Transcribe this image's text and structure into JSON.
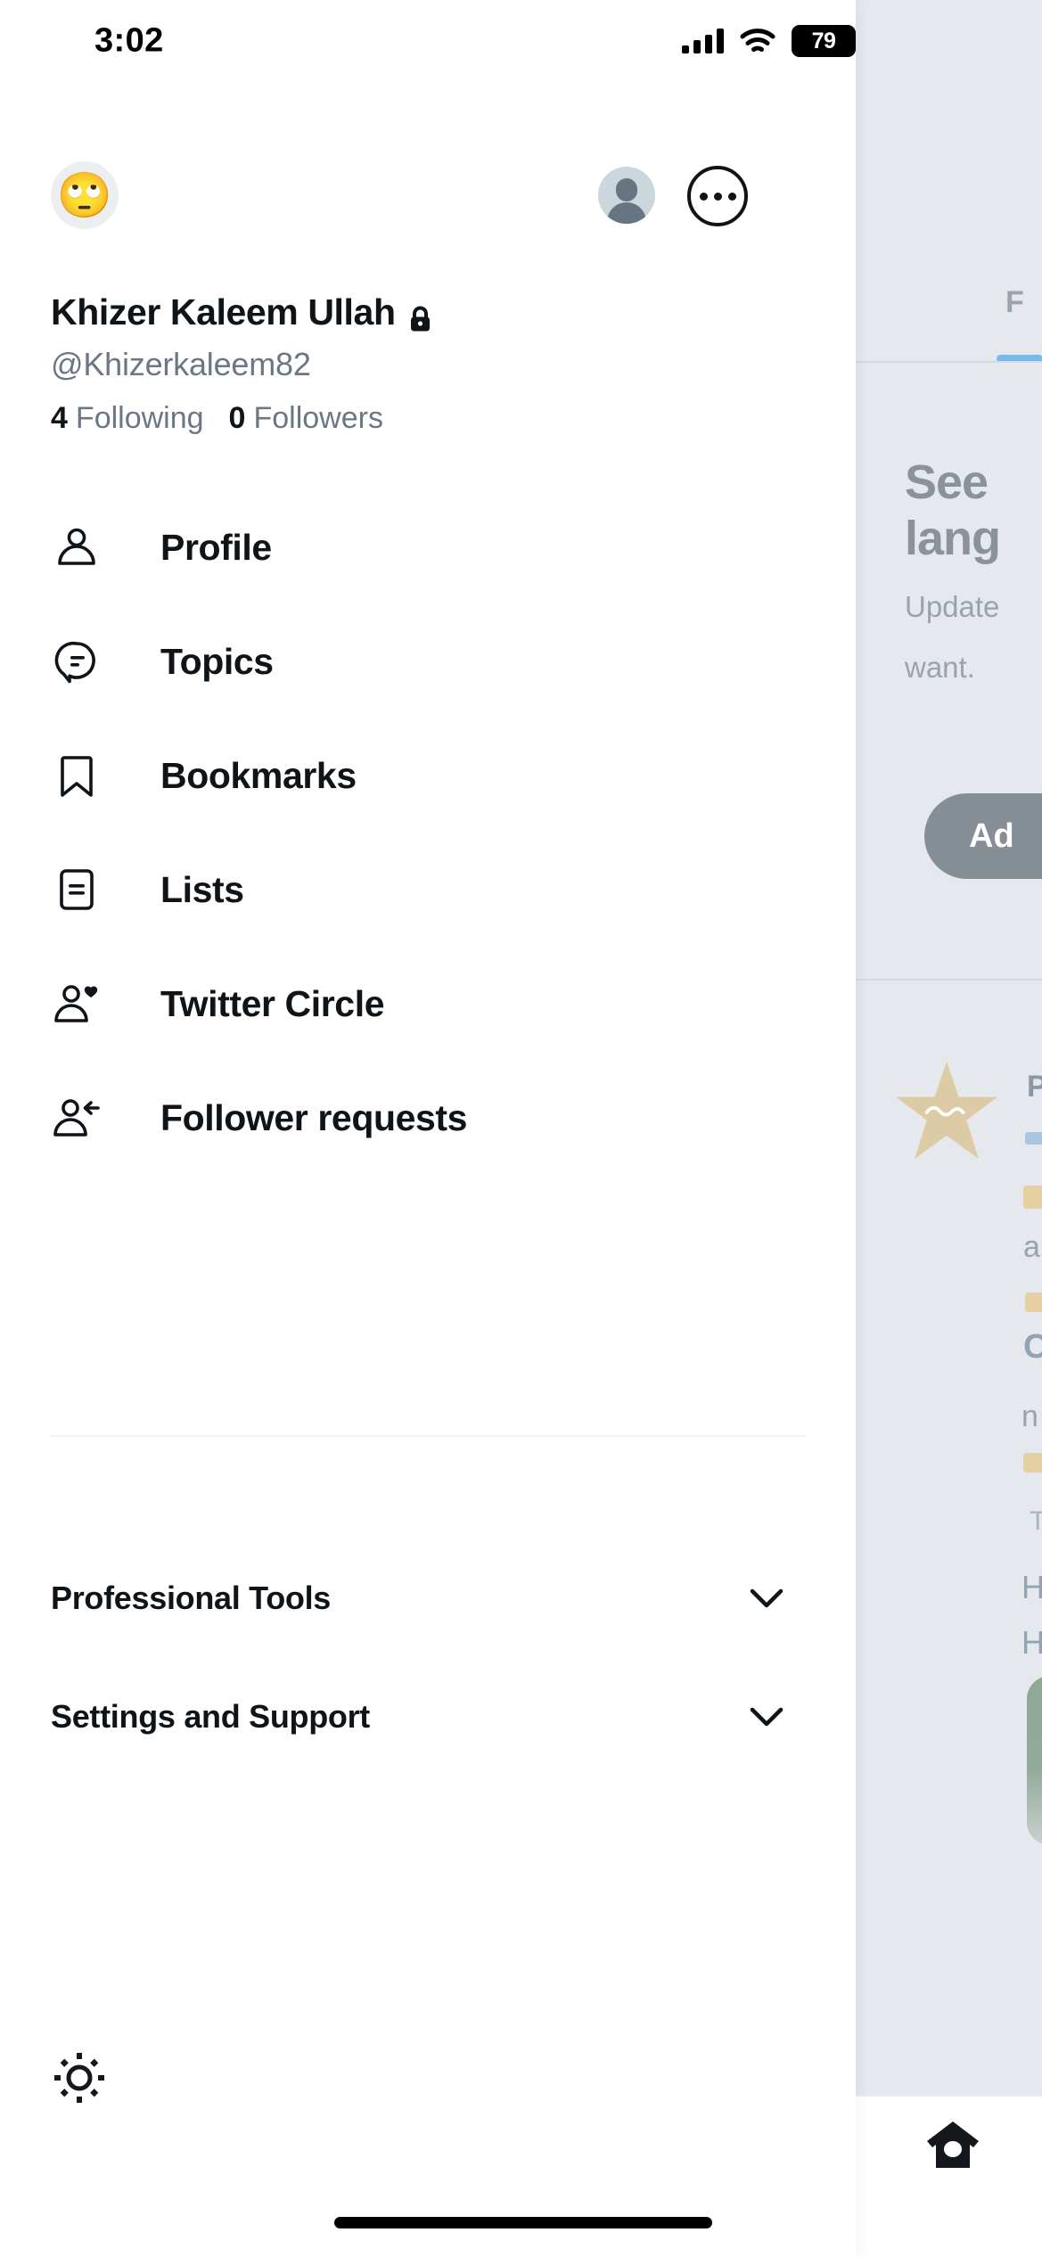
{
  "status_bar": {
    "time": "3:02",
    "battery_level": "79",
    "signal_icon": "cellular-signal-icon",
    "wifi_icon": "wifi-icon",
    "battery_icon": "battery-icon"
  },
  "account": {
    "avatar_emoji": "🙄",
    "avatar_icon": "account-avatar",
    "switch_account_icon": "account-switch-avatar-icon",
    "more_icon": "more-options-icon",
    "display_name": "Khizer Kaleem Ullah",
    "protected_icon": "lock-icon",
    "handle": "@Khizerkaleem82",
    "following_count": "4",
    "following_label": "Following",
    "followers_count": "0",
    "followers_label": "Followers"
  },
  "nav": {
    "items": [
      {
        "label": "Profile",
        "icon": "person-icon"
      },
      {
        "label": "Topics",
        "icon": "topics-speech-bubble-icon"
      },
      {
        "label": "Bookmarks",
        "icon": "bookmark-icon"
      },
      {
        "label": "Lists",
        "icon": "lists-icon"
      },
      {
        "label": "Twitter Circle",
        "icon": "person-heart-icon"
      },
      {
        "label": "Follower requests",
        "icon": "person-arrow-icon"
      }
    ]
  },
  "sections": [
    {
      "label": "Professional Tools",
      "chevron": "chevron-down-icon"
    },
    {
      "label": "Settings and Support",
      "chevron": "chevron-down-icon"
    }
  ],
  "footer": {
    "brightness_icon": "brightness-sun-icon"
  },
  "background": {
    "tab_label": "F",
    "promo_title_line1": "See",
    "promo_title_line2": "lang",
    "promo_sub_line1": "Update",
    "promo_sub_line2": "want.",
    "promo_button_label": "Ad",
    "post_author": "P",
    "post_line1": "a",
    "post_line2": "C",
    "post_line3": "n",
    "post_line4": "T",
    "post_line5": "H",
    "post_line6": "H",
    "star_icon": "pakistan-star-avatar-icon",
    "home_icon": "home-icon"
  },
  "colors": {
    "accent_blue": "#77b9e8",
    "dim_overlay": "#e5e9ed",
    "text_primary": "#0f1419",
    "text_secondary": "#6b7785",
    "star_gold": "#ddcba6"
  }
}
